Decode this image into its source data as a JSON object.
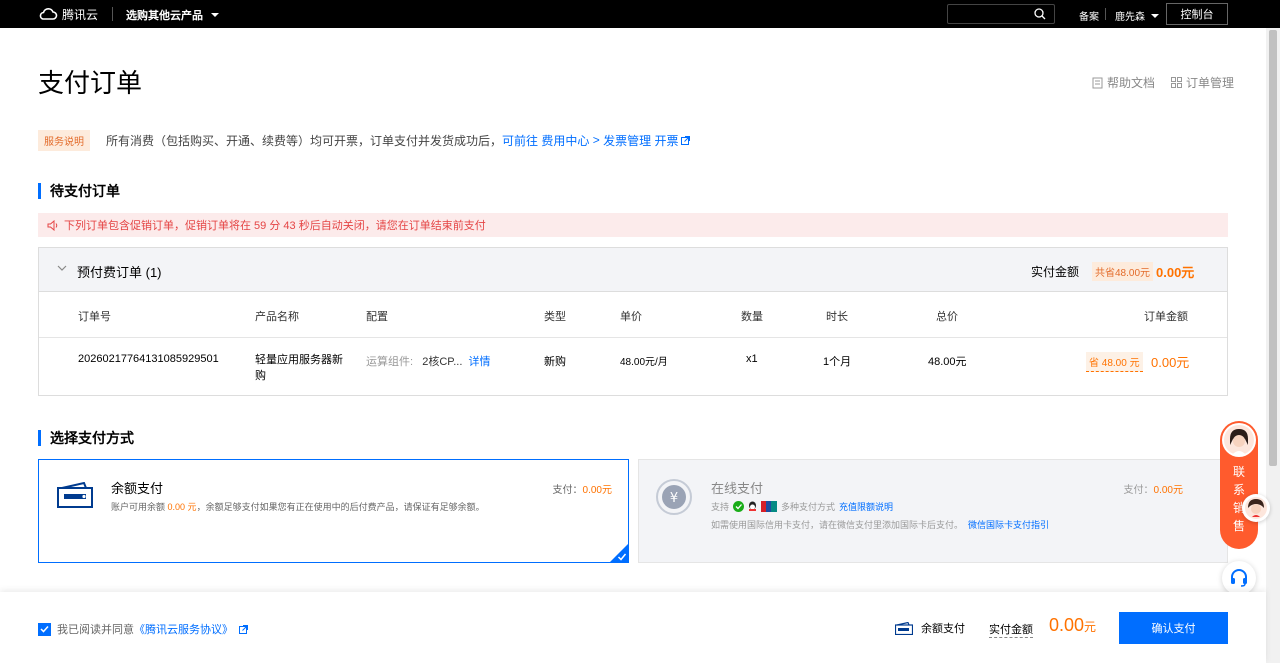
{
  "topbar": {
    "brand": "腾讯云",
    "product_selector": "选购其他云产品",
    "search_placeholder": "",
    "beian": "备案",
    "user": "鹿先森",
    "console": "控制台"
  },
  "page": {
    "title": "支付订单",
    "help_doc": "帮助文档",
    "order_manage": "订单管理"
  },
  "service_note": {
    "tag": "服务说明",
    "text": "所有消费（包括购买、开通、续费等）均可开票，订单支付并发货成功后，",
    "link_prefix": "可前往",
    "link1": "费用中心",
    "sep": ">",
    "link2": "发票管理",
    "link3": "开票"
  },
  "pending": {
    "heading": "待支付订单",
    "alert": "下列订单包含促销订单，促销订单将在 59 分 43 秒后自动关闭，请您在订单结束前支付",
    "group_title": "预付费订单 (1)",
    "pay_amount_label": "实付金额",
    "save_total": "共省48.00元",
    "pay_amount": "0.00元",
    "columns": [
      "订单号",
      "产品名称",
      "配置",
      "类型",
      "单价",
      "数量",
      "时长",
      "总价",
      "订单金额"
    ],
    "row": {
      "order_no": "20260217764131085929501",
      "product": "轻量应用服务器新购",
      "config_label": "运算组件:",
      "config_value": "2核CP...",
      "config_link": "详情",
      "type": "新购",
      "unit_price": "48.00元/月",
      "qty": "x1",
      "duration": "1个月",
      "total": "48.00元",
      "save": "省 48.00 元",
      "amount": "0.00元"
    }
  },
  "payment": {
    "heading": "选择支付方式",
    "balance": {
      "title": "余额支付",
      "desc_prefix": "账户可用余额",
      "balance_value": "0.00 元",
      "desc_suffix": "，余额足够支付如果您有正在使用中的后付费产品，请保证有足够余额。",
      "pay_label": "支付：",
      "pay_value": "0.00元"
    },
    "online": {
      "title": "在线支付",
      "support_label": "支持",
      "methods_text": "多种支付方式",
      "limit_link": "充值限额说明",
      "intl_text": "如需使用国际信用卡支付，请在微信支付里添加国际卡后支付。",
      "intl_link": "微信国际卡支付指引",
      "pay_label": "支付：",
      "pay_value": "0.00元"
    }
  },
  "bottom": {
    "agree_prefix": "我已阅读并同意",
    "agree_link": "《腾讯云服务协议》",
    "method": "余额支付",
    "pay_label": "实付金额",
    "amount": "0.00",
    "unit": "元",
    "confirm": "确认支付"
  },
  "float": {
    "contact_sales": [
      "联",
      "系",
      "销",
      "售"
    ]
  },
  "colors": {
    "accent": "#006eff",
    "orange": "#ff7200",
    "alert_bg": "#fcebeb",
    "alert_text": "#e54545"
  }
}
